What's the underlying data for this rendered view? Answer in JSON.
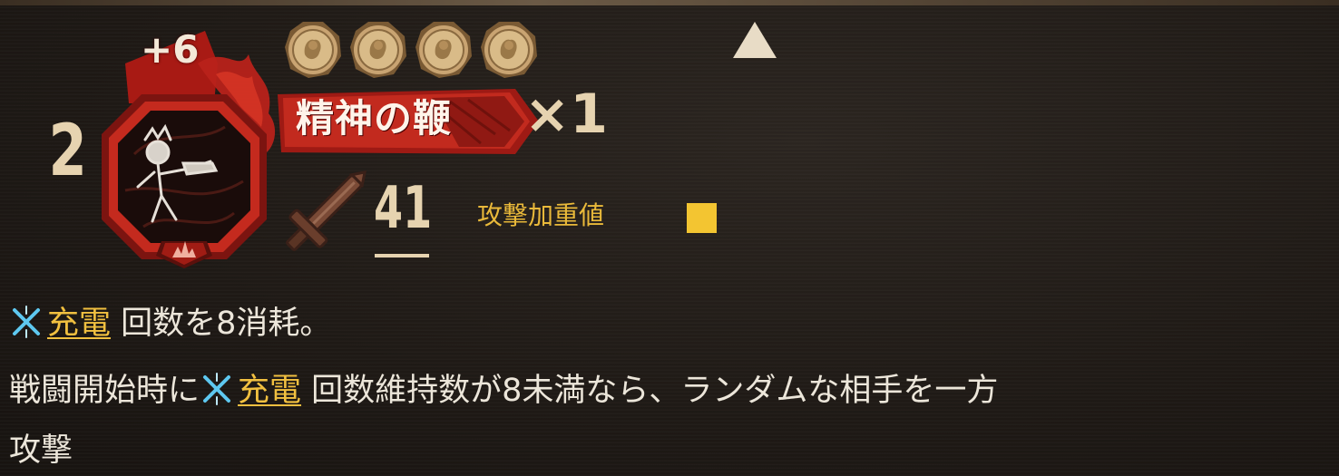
{
  "card": {
    "cost": "2",
    "level": "+6",
    "coins_count": 4,
    "name": "精神の鞭",
    "count": "×1",
    "attack": "41",
    "attribute_label": "攻撃加重値",
    "colors": {
      "frame_red": "#b3201a",
      "attribute_yellow": "#f3c531",
      "keyword_yellow": "#f1c040",
      "keyword_icon_blue": "#5ec8f0",
      "text": "#ece6da"
    }
  },
  "description": {
    "line1": {
      "keyword": "充電",
      "rest": " 回数を8消耗。"
    },
    "line2": {
      "prefix": "戦闘開始時に",
      "keyword": "充電",
      "rest": " 回数維持数が8未満なら、ランダムな相手を一方"
    },
    "line3": "攻撃"
  },
  "icons": {
    "emblem": "character-emblem-icon",
    "coin": "coin-icon",
    "sword": "sword-icon",
    "keyword": "charge-keyword-icon",
    "arrow": "up-arrow-icon",
    "flame": "flame-icon"
  }
}
